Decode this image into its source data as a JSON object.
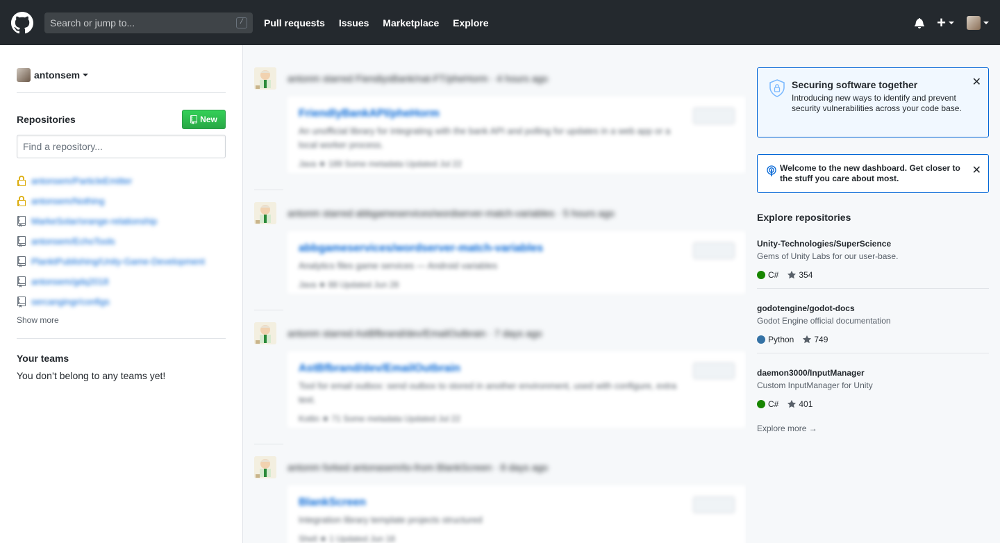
{
  "header": {
    "search_placeholder": "Search or jump to...",
    "slash_hint": "/",
    "nav": [
      "Pull requests",
      "Issues",
      "Marketplace",
      "Explore"
    ]
  },
  "sidebar": {
    "context_user": "antonsem",
    "repositories_title": "Repositories",
    "new_button": "New",
    "find_placeholder": "Find a repository...",
    "repos": [
      {
        "name": "antonsem/ParticleEmitter",
        "private": true
      },
      {
        "name": "antonsem/Nothing",
        "private": true
      },
      {
        "name": "MarkeSolar/orange-relationship",
        "private": false
      },
      {
        "name": "antonsem/EchoTools",
        "private": false
      },
      {
        "name": "PlanktPublishing/Unity-Game-Development",
        "private": false
      },
      {
        "name": "antonsem/gdq2018",
        "private": false
      },
      {
        "name": "sercangingr/configs",
        "private": false
      }
    ],
    "show_more": "Show more",
    "teams_title": "Your teams",
    "teams_text": "You don’t belong to any teams yet!"
  },
  "feed": {
    "events": [
      {
        "title": "antonm starred FiendiysBank/nat-FT/pheHorm · 4 hours ago",
        "repo": "FriendlyBankAPI/pheHorm",
        "desc": "An unofficial library for integrating with the bank API and polling for updates in a web app or a local worker process.",
        "meta": "Java   ★ 189   Some metadata   Updated Jul 22"
      },
      {
        "title": "antonm starred abbgameservices/wordserver-match-variables · 5 hours ago",
        "repo": "abbgameservices/wordserver-match-variables",
        "desc": "Analytics files game services — Android variables",
        "meta": "Java   ★ 88   Updated Jun 28"
      },
      {
        "title": "antonm starred AstBfbrand/dev/EmailOutbrain · 7 days ago",
        "repo": "AstBfbrand/dev/EmailOutbrain",
        "desc": "Tool for email outbox: send outbox to stored in another environment, used with configure, extra text.",
        "meta": "Kotlin   ★ 71   Some metadata   Updated Jul 22"
      },
      {
        "title": "antonm forked antonasem/to-from BlankScreen · 8 days ago",
        "repo": "BlankScreen",
        "desc": "Integration library template projects structured",
        "meta": "Shell   ★ 1   Updated Jun 18"
      }
    ]
  },
  "right": {
    "notice1": {
      "title": "Securing software together",
      "text": "Introducing new ways to identify and prevent security vulnerabilities across your code base."
    },
    "notice2": {
      "text": "Welcome to the new dashboard. Get closer to the stuff you care about most."
    },
    "explore_title": "Explore repositories",
    "explore": [
      {
        "name": "Unity-Technologies/SuperScience",
        "desc": "Gems of Unity Labs for our user-base.",
        "lang": "C#",
        "color": "#178600",
        "stars": "354"
      },
      {
        "name": "godotengine/godot-docs",
        "desc": "Godot Engine official documentation",
        "lang": "Python",
        "color": "#3572A5",
        "stars": "749"
      },
      {
        "name": "daemon3000/InputManager",
        "desc": "Custom InputManager for Unity",
        "lang": "C#",
        "color": "#178600",
        "stars": "401"
      }
    ],
    "explore_more": "Explore more →"
  }
}
